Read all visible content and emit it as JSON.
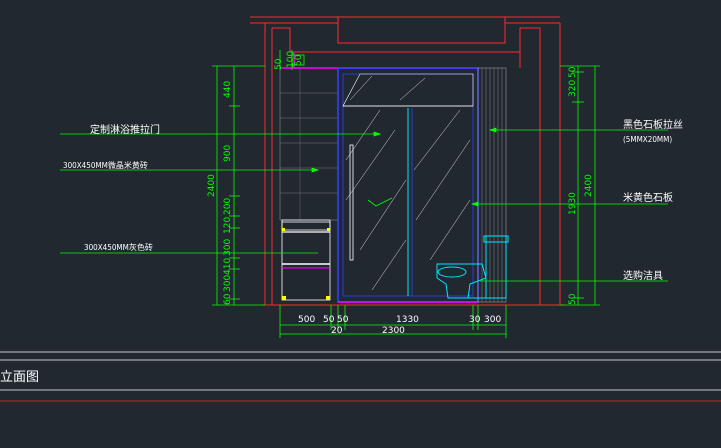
{
  "drawing": {
    "title": "立面图",
    "colors": {
      "background": "#212830",
      "wall": "#ff2a2a",
      "dimension": "#00ff00",
      "glass": "#00e5ff",
      "frame": "#3040ff",
      "accent": "#ff00ff",
      "fixture": "#00e5ff",
      "tile": "#ffffff"
    },
    "labels_left": [
      {
        "text": "定制淋浴推拉门"
      },
      {
        "text": "300X450MM微晶米黄砖"
      },
      {
        "text": "300X450MM灰色砖"
      }
    ],
    "labels_right": [
      {
        "text": "黑色石板拉丝"
      },
      {
        "text": "(5MMX20MM)"
      },
      {
        "text": "米黄色石板"
      },
      {
        "text": "选购洁具"
      }
    ],
    "dims_left_inner": [
      "50",
      "440",
      "900",
      "200",
      "120",
      "300",
      "410",
      "300",
      "60"
    ],
    "dims_left_total": "2400",
    "dims_right_inner": [
      "50",
      "320",
      "1930",
      "50"
    ],
    "dims_right_total": "2400",
    "dims_top_small": [
      "100",
      "50"
    ],
    "dims_bottom": [
      "500",
      "50",
      "50",
      "1330",
      "30",
      "300"
    ],
    "dims_bottom_sub": "20",
    "dims_bottom_total": "2300"
  }
}
